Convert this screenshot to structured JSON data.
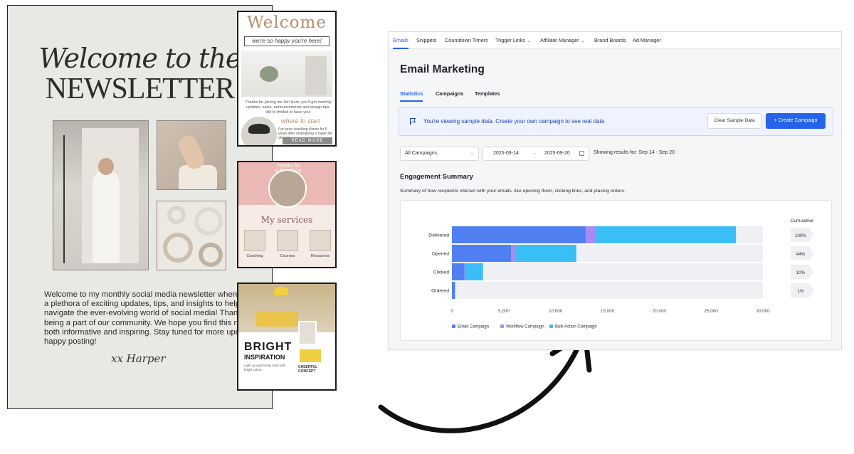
{
  "newsletter": {
    "title_line1": "Welcome to the",
    "title_line2": "NEWSLETTER",
    "body": "Welcome to my monthly social media newsletter where I share a plethora of exciting updates, tips, and insights to help you navigate the ever-evolving world of social media! Thank you for being a part of our community. We hope you find this newsletter both informative and inspiring. Stay tuned for more updates and happy posting!",
    "signature": "xx Harper"
  },
  "template_cards": {
    "welcome": {
      "heading": "Welcome",
      "subheading": "we're so happy you're here!",
      "intro": "Thanks for joining our list! Here, you'll get monthly updates, sales, announcements and design tips. We're thrilled to have you!",
      "script": "where to start",
      "small_text": "I've been coaching clients for 5 years after undergoing a major life change.",
      "button": "READ MORE"
    },
    "services": {
      "ribbon": "Thanks for subscribing!",
      "heading": "My services",
      "items": [
        "Coaching",
        "Courses",
        "Resources"
      ]
    },
    "bright": {
      "title": "BRIGHT",
      "subtitle": "INSPIRATION",
      "concept": "CHEERFUL CONCEPT",
      "small_text": "Light up your living room with bright colors."
    }
  },
  "app": {
    "nav": {
      "items": [
        {
          "label": "Emails",
          "active": true
        },
        {
          "label": "Snippets"
        },
        {
          "label": "Countdown Timers"
        },
        {
          "label": "Trigger Links",
          "dropdown": true
        },
        {
          "label": "Affiliate Manager",
          "dropdown": true
        },
        {
          "label": "Brand Boards"
        },
        {
          "label": "Ad Manager"
        }
      ]
    },
    "page_title": "Email Marketing",
    "tabs": [
      {
        "label": "Statistics",
        "active": true
      },
      {
        "label": "Campaigns"
      },
      {
        "label": "Templates"
      }
    ],
    "banner": {
      "text": "You're viewing sample data. Create your own campaign to see real data",
      "clear_button": "Clear Sample Data",
      "create_button": "+ Create Campaign",
      "icon": "flag-icon"
    },
    "filters": {
      "campaign_select": "All Campaigns",
      "date_start": "2025-09-14",
      "date_arrow": "→",
      "date_end": "2025-09-20",
      "results": "Showing results for: Sep 14 - Sep 20"
    },
    "engagement": {
      "title": "Engagement Summary",
      "description": "Summary of how recipients interact with your emails, like opening them, clicking links, and placing orders."
    }
  },
  "chart_data": {
    "type": "bar",
    "orientation": "horizontal",
    "stacked": true,
    "categories": [
      "Delivered",
      "Opened",
      "Clicked",
      "Ordered"
    ],
    "series": [
      {
        "name": "Email Campaign",
        "color": "#4f7ff0",
        "values": [
          12900,
          5700,
          1200,
          300
        ]
      },
      {
        "name": "Workflow Campaign",
        "color": "#a78bf2",
        "values": [
          1000,
          400,
          100,
          0
        ]
      },
      {
        "name": "Bulk Action Campaign",
        "color": "#39bff5",
        "values": [
          13500,
          5900,
          1700,
          0
        ]
      }
    ],
    "xlim": [
      0,
      30000
    ],
    "xticks": [
      "0",
      "5,000",
      "10,000",
      "15,000",
      "20,000",
      "25,000",
      "30,000"
    ],
    "cumulative_title": "Cumulative",
    "cumulative": [
      "100%",
      "44%",
      "10%",
      "1%"
    ],
    "legend_position": "bottom-left",
    "grid": false
  }
}
